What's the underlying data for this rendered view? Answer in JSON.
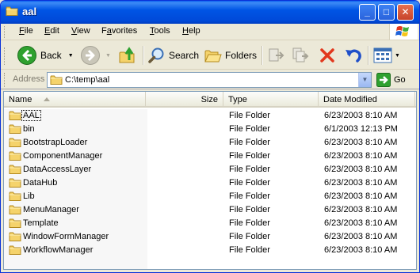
{
  "window": {
    "title": "aal"
  },
  "titlebar_buttons": {
    "minimize": "_",
    "maximize": "□",
    "close": "✕"
  },
  "menu": [
    "File",
    "Edit",
    "View",
    "Favorites",
    "Tools",
    "Help"
  ],
  "menu_mnemonics": [
    "F",
    "E",
    "V",
    "a",
    "T",
    "H"
  ],
  "toolbar": {
    "back_label": "Back",
    "search_label": "Search",
    "folders_label": "Folders"
  },
  "address": {
    "label": "Address",
    "value": "C:\\temp\\aal",
    "go_label": "Go"
  },
  "columns": {
    "name": "Name",
    "size": "Size",
    "type": "Type",
    "date": "Date Modified"
  },
  "files": [
    {
      "name": "AAL",
      "size": "",
      "type": "File Folder",
      "date": "6/23/2003 8:10 AM"
    },
    {
      "name": "bin",
      "size": "",
      "type": "File Folder",
      "date": "6/1/2003 12:13 PM"
    },
    {
      "name": "BootstrapLoader",
      "size": "",
      "type": "File Folder",
      "date": "6/23/2003 8:10 AM"
    },
    {
      "name": "ComponentManager",
      "size": "",
      "type": "File Folder",
      "date": "6/23/2003 8:10 AM"
    },
    {
      "name": "DataAccessLayer",
      "size": "",
      "type": "File Folder",
      "date": "6/23/2003 8:10 AM"
    },
    {
      "name": "DataHub",
      "size": "",
      "type": "File Folder",
      "date": "6/23/2003 8:10 AM"
    },
    {
      "name": "Lib",
      "size": "",
      "type": "File Folder",
      "date": "6/23/2003 8:10 AM"
    },
    {
      "name": "MenuManager",
      "size": "",
      "type": "File Folder",
      "date": "6/23/2003 8:10 AM"
    },
    {
      "name": "Template",
      "size": "",
      "type": "File Folder",
      "date": "6/23/2003 8:10 AM"
    },
    {
      "name": "WindowFormManager",
      "size": "",
      "type": "File Folder",
      "date": "6/23/2003 8:10 AM"
    },
    {
      "name": "WorkflowManager",
      "size": "",
      "type": "File Folder",
      "date": "6/23/2003 8:10 AM"
    }
  ],
  "icons": {
    "title": "folder-icon",
    "back": "back-arrow-icon",
    "forward": "forward-arrow-icon",
    "up": "up-folder-icon",
    "search": "magnifier-icon",
    "folders": "folders-icon",
    "move_to": "move-to-icon",
    "copy_to": "copy-to-icon",
    "delete": "delete-x-icon",
    "undo": "undo-icon",
    "views": "views-icon",
    "go": "go-arrow-icon"
  },
  "colors": {
    "titlebar": "#0055e5",
    "accent_green": "#2fa12f",
    "delete_red": "#e2381d",
    "undo_blue": "#1f4fc9",
    "folder_yellow": "#f5d36b"
  }
}
